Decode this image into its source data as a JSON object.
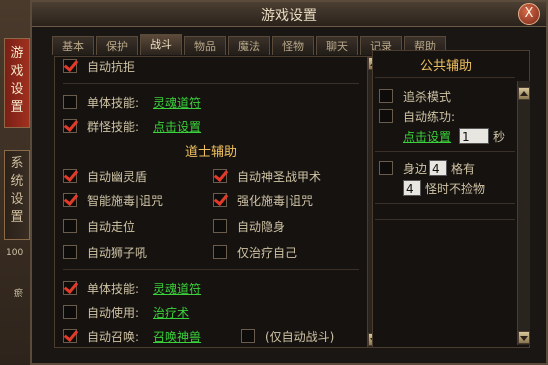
{
  "window": {
    "title": "游戏设置",
    "close_label": "X"
  },
  "side_tabs": {
    "game": "游\n戏\n设\n置",
    "system": "系\n统\n设\n置"
  },
  "background": {
    "num": "100",
    "num2": "瘀"
  },
  "tabs": [
    "基本",
    "保护",
    "战斗",
    "物品",
    "魔法",
    "怪物",
    "聊天",
    "记录",
    "帮助"
  ],
  "left": {
    "auto_refuse": "自动抗拒",
    "single_skill_label": "单体技能:",
    "single_skill_value": "灵魂道符",
    "group_skill_label": "群怪技能:",
    "group_skill_value": "点击设置",
    "section_title": "道士辅助",
    "opts": [
      {
        "label": "自动幽灵盾",
        "checked": true
      },
      {
        "label": "自动神圣战甲术",
        "checked": true
      },
      {
        "label": "智能施毒|诅咒",
        "checked": true
      },
      {
        "label": "强化施毒|诅咒",
        "checked": true
      },
      {
        "label": "自动走位",
        "checked": false
      },
      {
        "label": "自动隐身",
        "checked": false
      },
      {
        "label": "自动狮子吼",
        "checked": false
      },
      {
        "label": "仅治疗自己",
        "checked": false
      }
    ],
    "b_single_label": "单体技能:",
    "b_single_value": "灵魂道符",
    "auto_use_label": "自动使用:",
    "auto_use_value": "治疗术",
    "auto_summon_label": "自动召唤:",
    "auto_summon_value": "召唤神兽",
    "only_auto_fight": "(仅自动战斗)"
  },
  "right": {
    "title": "公共辅助",
    "chase_mode": "追杀模式",
    "auto_practice": "自动练功:",
    "practice_link": "点击设置",
    "practice_value": "1",
    "seconds": "秒",
    "nearby": "身边",
    "nearby_value": "4",
    "grid_has": "格有",
    "monster_value": "4",
    "no_pickup": "怪时不捡物"
  }
}
